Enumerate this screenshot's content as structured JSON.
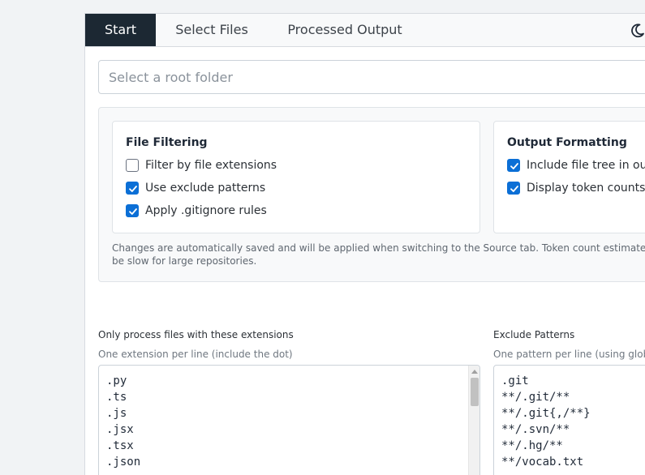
{
  "tabs": [
    {
      "label": "Start",
      "active": true
    },
    {
      "label": "Select Files",
      "active": false
    },
    {
      "label": "Processed Output",
      "active": false
    }
  ],
  "theme_toggle": {
    "icon": "moon-icon"
  },
  "root_folder": {
    "value": "",
    "placeholder": "Select a root folder"
  },
  "file_filtering": {
    "title": "File Filtering",
    "options": [
      {
        "label": "Filter by file extensions",
        "checked": false
      },
      {
        "label": "Use exclude patterns",
        "checked": true
      },
      {
        "label": "Apply .gitignore rules",
        "checked": true
      }
    ]
  },
  "output_formatting": {
    "title": "Output Formatting",
    "options": [
      {
        "label": "Include file tree in output",
        "checked": true
      },
      {
        "label": "Display token counts",
        "checked": true
      }
    ]
  },
  "settings_note": "Changes are automatically saved and will be applied when switching to the Source tab. Token count estimates may be slow for large repositories.",
  "extensions": {
    "label": "Only process files with these extensions",
    "hint": "One extension per line (include the dot)",
    "lines": [
      ".py",
      ".ts",
      ".js",
      ".jsx",
      ".tsx",
      ".json"
    ]
  },
  "exclude_patterns": {
    "label": "Exclude Patterns",
    "hint": "One pattern per line (using glob patterns)",
    "lines": [
      ".git",
      "**/.git/**",
      "**/.git{,/**}",
      "**/.svn/**",
      "**/.hg/**",
      "**/vocab.txt"
    ]
  },
  "colors": {
    "active_tab_bg": "#1c2833",
    "checkbox_accent": "#0b6fd6"
  }
}
